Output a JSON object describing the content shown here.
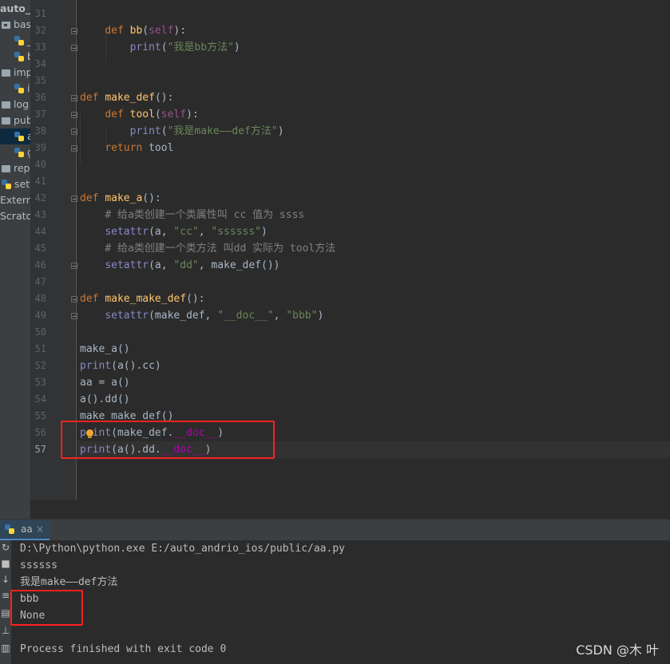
{
  "project_tree": {
    "items": [
      {
        "label": "auto_a",
        "kind": "root"
      },
      {
        "label": "bas",
        "kind": "package"
      },
      {
        "label": "_",
        "kind": "py"
      },
      {
        "label": "b",
        "kind": "py"
      },
      {
        "label": "imp",
        "kind": "folder"
      },
      {
        "label": "i",
        "kind": "py"
      },
      {
        "label": "log",
        "kind": "folder"
      },
      {
        "label": "pub",
        "kind": "folder"
      },
      {
        "label": "a",
        "kind": "py",
        "selected": true
      },
      {
        "label": "g",
        "kind": "py"
      },
      {
        "label": "rep",
        "kind": "folder"
      },
      {
        "label": "sett",
        "kind": "py"
      },
      {
        "label": "Externa",
        "kind": "text"
      },
      {
        "label": "Scratch",
        "kind": "text"
      }
    ]
  },
  "editor": {
    "current_line": "57",
    "lines": [
      {
        "n": "31",
        "text": ""
      },
      {
        "n": "32",
        "text": "    def bb(self):"
      },
      {
        "n": "33",
        "text": "        print(\"我是bb方法\")"
      },
      {
        "n": "34",
        "text": ""
      },
      {
        "n": "35",
        "text": ""
      },
      {
        "n": "36",
        "text": "def make_def():"
      },
      {
        "n": "37",
        "text": "    def tool(self):"
      },
      {
        "n": "38",
        "text": "        print(\"我是make——def方法\")"
      },
      {
        "n": "39",
        "text": "    return tool"
      },
      {
        "n": "40",
        "text": ""
      },
      {
        "n": "41",
        "text": ""
      },
      {
        "n": "42",
        "text": "def make_a():"
      },
      {
        "n": "43",
        "text": "    # 给a类创建一个类属性叫 cc 值为 ssss"
      },
      {
        "n": "44",
        "text": "    setattr(a, \"cc\", \"ssssss\")"
      },
      {
        "n": "45",
        "text": "    # 给a类创建一个类方法 叫dd 实际为 tool方法"
      },
      {
        "n": "46",
        "text": "    setattr(a, \"dd\", make_def())"
      },
      {
        "n": "47",
        "text": ""
      },
      {
        "n": "48",
        "text": "def make_make_def():"
      },
      {
        "n": "49",
        "text": "    setattr(make_def, \"__doc__\", \"bbb\")"
      },
      {
        "n": "50",
        "text": ""
      },
      {
        "n": "51",
        "text": "make_a()"
      },
      {
        "n": "52",
        "text": "print(a().cc)"
      },
      {
        "n": "53",
        "text": "aa = a()"
      },
      {
        "n": "54",
        "text": "a().dd()"
      },
      {
        "n": "55",
        "text": "make_make_def()"
      },
      {
        "n": "56",
        "text": "print(make_def.__doc__)"
      },
      {
        "n": "57",
        "text": "print(a().dd.__doc__)"
      }
    ]
  },
  "run_panel": {
    "tab_label": "aa",
    "tab_close": "×",
    "output": [
      "D:\\Python\\python.exe E:/auto_andrio_ios/public/aa.py",
      "ssssss",
      "我是make——def方法",
      "bbb",
      "None",
      "",
      "Process finished with exit code 0"
    ]
  },
  "watermark": "CSDN @木 叶",
  "colors": {
    "keyword": "#cc7832",
    "function": "#ffc66d",
    "string": "#6a8759",
    "comment": "#808080",
    "builtin": "#8888c6",
    "self": "#94558d",
    "dunder": "#b200b2",
    "annotation_box": "#ff2020"
  }
}
